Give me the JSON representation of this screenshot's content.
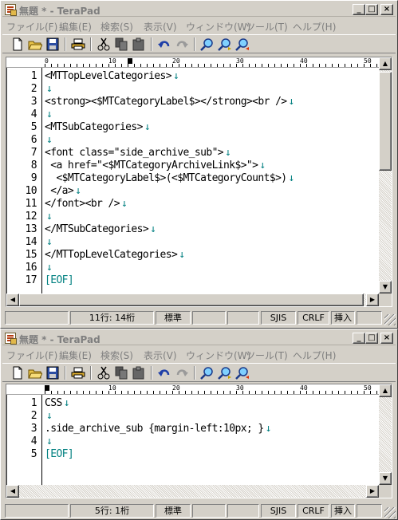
{
  "windows": [
    {
      "title": "無題 * - TeraPad",
      "menu": [
        "ファイル(F)",
        "編集(E)",
        "検索(S)",
        "表示(V)",
        "ウィンドウ(W)",
        "ツール(T)",
        "ヘルプ(H)"
      ],
      "ruler": [
        "0",
        "10",
        "20",
        "30",
        "40",
        "50"
      ],
      "lines": [
        {
          "num": "1",
          "text": "<MTTopLevelCategories>",
          "eol": "↓"
        },
        {
          "num": "2",
          "text": "",
          "eol": "↓"
        },
        {
          "num": "3",
          "text": "<strong><$MTCategoryLabel$></strong><br />",
          "eol": "↓"
        },
        {
          "num": "4",
          "text": "",
          "eol": "↓"
        },
        {
          "num": "5",
          "text": "<MTSubCategories>",
          "eol": "↓"
        },
        {
          "num": "6",
          "text": "",
          "eol": "↓"
        },
        {
          "num": "7",
          "text": "<font class=\"side_archive_sub\">",
          "eol": "↓"
        },
        {
          "num": "8",
          "text": " <a href=\"<$MTCategoryArchiveLink$>\">",
          "eol": "↓"
        },
        {
          "num": "9",
          "text": "  <$MTCategoryLabel$>(<$MTCategoryCount$>)",
          "eol": "↓"
        },
        {
          "num": "10",
          "text": " </a>",
          "eol": "↓"
        },
        {
          "num": "11",
          "text": "</font><br />",
          "eol": "↓"
        },
        {
          "num": "12",
          "text": "",
          "eol": "↓"
        },
        {
          "num": "13",
          "text": "</MTSubCategories>",
          "eol": "↓"
        },
        {
          "num": "14",
          "text": "",
          "eol": "↓"
        },
        {
          "num": "15",
          "text": "</MTTopLevelCategories>",
          "eol": "↓"
        },
        {
          "num": "16",
          "text": "",
          "eol": "↓"
        },
        {
          "num": "17",
          "text": "",
          "eol": "",
          "eof": "[EOF]"
        }
      ],
      "status": {
        "position": "11行:  14桁",
        "mode": "標準",
        "encoding": "SJIS",
        "newline": "CRLF",
        "insert": "挿入"
      }
    },
    {
      "title": "無題 * - TeraPad",
      "menu": [
        "ファイル(F)",
        "編集(E)",
        "検索(S)",
        "表示(V)",
        "ウィンドウ(W)",
        "ツール(T)",
        "ヘルプ(H)"
      ],
      "ruler": [
        "0",
        "10",
        "20",
        "30",
        "40",
        "50"
      ],
      "lines": [
        {
          "num": "1",
          "text": "CSS",
          "eol": "↓"
        },
        {
          "num": "2",
          "text": "",
          "eol": "↓"
        },
        {
          "num": "3",
          "text": ".side_archive_sub {margin-left:10px; }",
          "eol": "↓"
        },
        {
          "num": "4",
          "text": "",
          "eol": "↓"
        },
        {
          "num": "5",
          "text": "",
          "eol": "",
          "eof": "[EOF]"
        }
      ],
      "status": {
        "position": "5行:   1桁",
        "mode": "標準",
        "encoding": "SJIS",
        "newline": "CRLF",
        "insert": "挿入"
      }
    }
  ],
  "caption_buttons": {
    "minimize": "_",
    "maximize": "□",
    "close": "×"
  },
  "scroll_arrows": {
    "up": "▲",
    "down": "▼",
    "left": "◀",
    "right": "▶"
  },
  "toolbar_icons": [
    "new-file-icon",
    "open-folder-icon",
    "save-icon",
    "print-icon",
    "cut-icon",
    "copy-icon",
    "paste-icon",
    "undo-icon",
    "redo-icon",
    "find-icon",
    "find-next-icon",
    "find-previous-icon"
  ],
  "colors": {
    "face": "#d4d0c8",
    "eol_mark": "#008080",
    "disabled_text": "#7f7f7f"
  }
}
